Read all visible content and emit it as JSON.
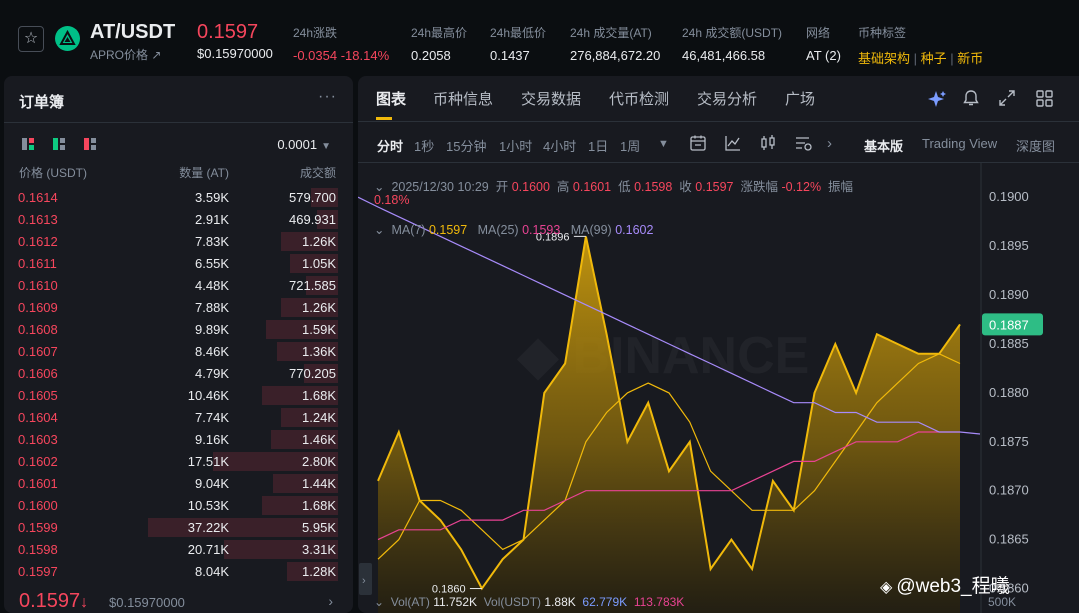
{
  "ticker": {
    "pair": "AT/USDT",
    "coin_name": "APRO价格",
    "price": "0.1597",
    "price_usd": "$0.15970000",
    "stats": [
      {
        "label": "24h涨跌",
        "value": "-0.0354 -18.14%",
        "color": "red"
      },
      {
        "label": "24h最高价",
        "value": "0.2058",
        "color": "white"
      },
      {
        "label": "24h最低价",
        "value": "0.1437",
        "color": "white"
      },
      {
        "label": "24h 成交量(AT)",
        "value": "276,884,672.20",
        "color": "white"
      },
      {
        "label": "24h 成交额(USDT)",
        "value": "46,481,466.58",
        "color": "white"
      },
      {
        "label": "网络",
        "value": "AT (2)",
        "color": "white"
      }
    ],
    "tags_label": "币种标签",
    "tags": [
      "基础架构",
      "种子",
      "新币"
    ]
  },
  "orderbook": {
    "title": "订单簿",
    "tick_size": "0.0001",
    "headers": {
      "price": "价格 (USDT)",
      "qty": "数量 (AT)",
      "total": "成交额"
    },
    "asks": [
      {
        "price": "0.1614",
        "qty": "3.59K",
        "total": "579.700",
        "depth": 0.14
      },
      {
        "price": "0.1613",
        "qty": "2.91K",
        "total": "469.931",
        "depth": 0.11
      },
      {
        "price": "0.1612",
        "qty": "7.83K",
        "total": "1.26K",
        "depth": 0.3
      },
      {
        "price": "0.1611",
        "qty": "6.55K",
        "total": "1.05K",
        "depth": 0.25
      },
      {
        "price": "0.1610",
        "qty": "4.48K",
        "total": "721.585",
        "depth": 0.17
      },
      {
        "price": "0.1609",
        "qty": "7.88K",
        "total": "1.26K",
        "depth": 0.3
      },
      {
        "price": "0.1608",
        "qty": "9.89K",
        "total": "1.59K",
        "depth": 0.38
      },
      {
        "price": "0.1607",
        "qty": "8.46K",
        "total": "1.36K",
        "depth": 0.32
      },
      {
        "price": "0.1606",
        "qty": "4.79K",
        "total": "770.205",
        "depth": 0.18
      },
      {
        "price": "0.1605",
        "qty": "10.46K",
        "total": "1.68K",
        "depth": 0.4
      },
      {
        "price": "0.1604",
        "qty": "7.74K",
        "total": "1.24K",
        "depth": 0.3
      },
      {
        "price": "0.1603",
        "qty": "9.16K",
        "total": "1.46K",
        "depth": 0.35
      },
      {
        "price": "0.1602",
        "qty": "17.51K",
        "total": "2.80K",
        "depth": 0.66
      },
      {
        "price": "0.1601",
        "qty": "9.04K",
        "total": "1.44K",
        "depth": 0.34
      },
      {
        "price": "0.1600",
        "qty": "10.53K",
        "total": "1.68K",
        "depth": 0.4
      },
      {
        "price": "0.1599",
        "qty": "37.22K",
        "total": "5.95K",
        "depth": 1.0
      },
      {
        "price": "0.1598",
        "qty": "20.71K",
        "total": "3.31K",
        "depth": 0.6
      },
      {
        "price": "0.1597",
        "qty": "8.04K",
        "total": "1.28K",
        "depth": 0.27
      }
    ],
    "last_price": "0.1597",
    "last_arrow": "↓",
    "last_usd": "$0.15970000"
  },
  "chart_panel": {
    "tabs": [
      "图表",
      "币种信息",
      "交易数据",
      "代币检测",
      "交易分析",
      "广场"
    ],
    "intervals": [
      "分时",
      "1秒",
      "15分钟",
      "1小时",
      "4小时",
      "1日",
      "1周"
    ],
    "modes": [
      "基本版",
      "Trading View",
      "深度图"
    ],
    "info": {
      "date": "2025/12/30 10:29",
      "open_label": "开",
      "open": "0.1600",
      "high_label": "高",
      "high": "0.1601",
      "low_label": "低",
      "low": "0.1598",
      "close_label": "收",
      "close": "0.1597",
      "change_label": "涨跌幅",
      "change": "-0.12%",
      "amp_label": "振幅",
      "amp": "0.18%"
    },
    "ma_line": {
      "ma7_label": "MA(7)",
      "ma7": "0.1597",
      "ma25_label": "MA(25)",
      "ma25": "0.1593",
      "ma99_label": "MA(99)",
      "ma99": "0.1602"
    },
    "vol_line": {
      "vol_label": "Vol(AT)",
      "vol": "11.752K",
      "vol_usdt_label": "Vol(USDT)",
      "vol_usdt": "1.88K",
      "v1": "62.779K",
      "v2": "113.783K",
      "axis": "500K"
    }
  },
  "chart_data": {
    "type": "area",
    "yticks": [
      "0.1900",
      "0.1895",
      "0.1890",
      "0.1885",
      "0.1880",
      "0.1875",
      "0.1870",
      "0.1865",
      "0.1860"
    ],
    "ylim": [
      0.18575,
      0.19035
    ],
    "current_price_label": "0.1887",
    "high_label": "0.1896",
    "low_label": "0.1860",
    "price": [
      0.1871,
      0.1876,
      0.1869,
      0.1867,
      0.1864,
      0.186,
      0.1863,
      0.1865,
      0.188,
      0.1883,
      0.1896,
      0.1886,
      0.1875,
      0.1879,
      0.1872,
      0.1875,
      0.1862,
      0.1865,
      0.1862,
      0.1871,
      0.1868,
      0.188,
      0.1885,
      0.188,
      0.1886,
      0.1885,
      0.1884,
      0.1884,
      0.1887
    ],
    "ma7": [
      0.1863,
      0.1865,
      0.1869,
      0.1869,
      0.1868,
      0.1866,
      0.1864,
      0.1865,
      0.1867,
      0.1869,
      0.1875,
      0.1878,
      0.188,
      0.1881,
      0.188,
      0.1877,
      0.1872,
      0.187,
      0.1868,
      0.1868,
      0.1868,
      0.187,
      0.1873,
      0.1876,
      0.1879,
      0.1881,
      0.1883,
      0.1884,
      0.1883
    ],
    "ma25": [
      0.1865,
      0.1866,
      0.1866,
      0.1866,
      0.1867,
      0.1867,
      0.1867,
      0.1868,
      0.1868,
      0.1869,
      0.187,
      0.187,
      0.187,
      0.187,
      0.187,
      0.187,
      0.187,
      0.187,
      0.1871,
      0.1872,
      0.1873,
      0.1873,
      0.1874,
      0.1875,
      0.1875,
      0.1875,
      0.1876,
      0.1876,
      0.1876
    ],
    "ma99": [
      0.1899,
      0.1898,
      0.1897,
      0.1896,
      0.1895,
      0.1894,
      0.1893,
      0.1892,
      0.1891,
      0.189,
      0.1889,
      0.1888,
      0.1887,
      0.1886,
      0.1885,
      0.1884,
      0.1883,
      0.1882,
      0.1881,
      0.188,
      0.1879,
      0.1879,
      0.1878,
      0.1878,
      0.1877,
      0.1877,
      0.1877,
      0.1876,
      0.1876
    ]
  },
  "colors": {
    "up": "#0ecb81",
    "down": "#f6465d",
    "accent": "#f0b90b"
  },
  "watermark": "@web3_程曦"
}
